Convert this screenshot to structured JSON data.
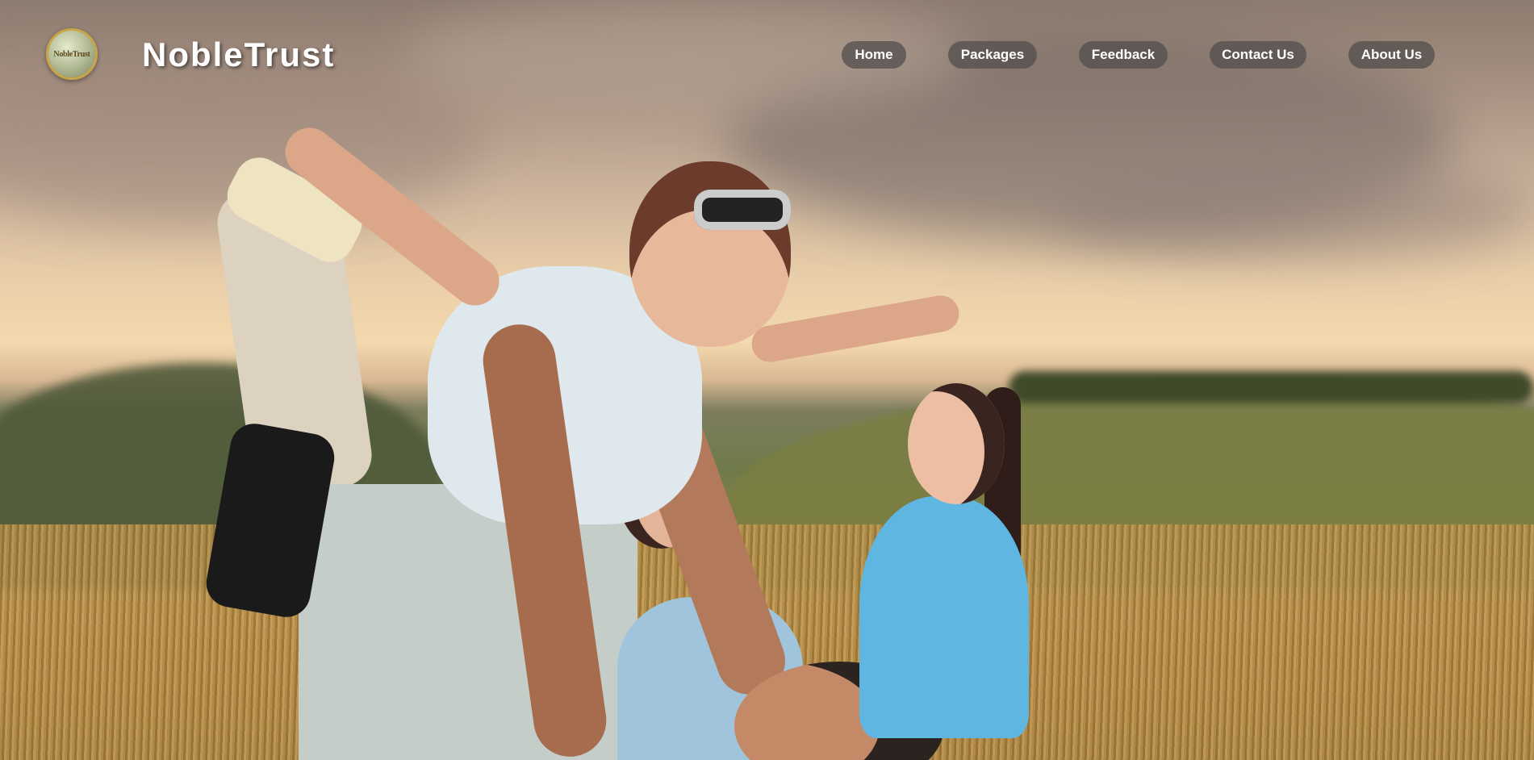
{
  "header": {
    "logo_text": "NobleTrust",
    "brand_name": "NobleTrust"
  },
  "nav": {
    "items": [
      {
        "label": "Home"
      },
      {
        "label": "Packages"
      },
      {
        "label": "Feedback"
      },
      {
        "label": "Contact Us"
      },
      {
        "label": "About Us"
      }
    ]
  },
  "hero": {
    "image": "family-in-field-hero-image"
  },
  "colors": {
    "nav_button_bg": "#55504e",
    "brand_text": "#ffffff",
    "logo_ring": "#c9a54a"
  }
}
